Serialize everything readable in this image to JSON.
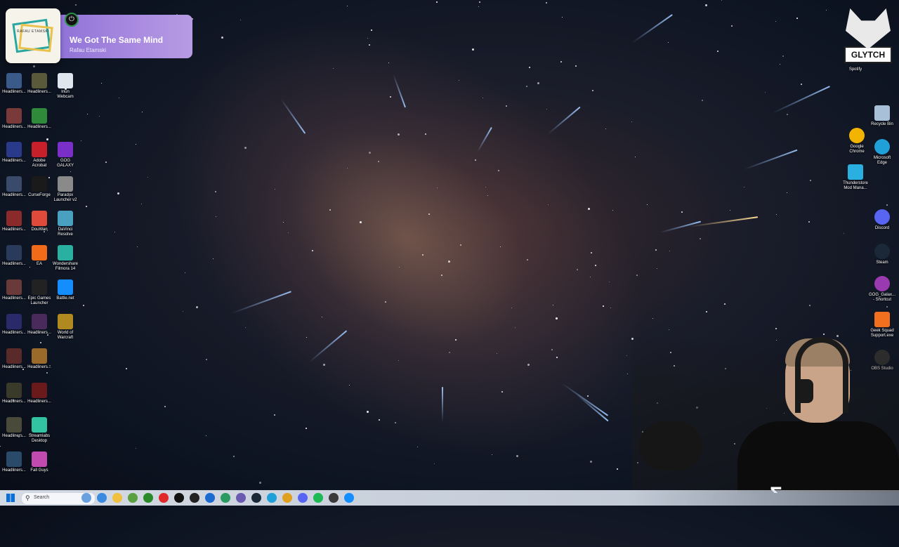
{
  "now_playing": {
    "title": "We Got The Same Mind",
    "artist": "Rafau Etamski",
    "art_text": "RAFAU ETAMSKI"
  },
  "left_icons": [
    {
      "name": "headliners-1",
      "label": "Headliners...",
      "color": "#3a5a8a"
    },
    {
      "name": "headliners-2",
      "label": "Headliners...",
      "color": "#5a5a3a"
    },
    {
      "name": "inun-webcam",
      "label": "Inun\nWebcam",
      "color": "#dfe6ee"
    },
    {
      "name": "headliners-3",
      "label": "Headliners...",
      "color": "#7a3a3a"
    },
    {
      "name": "headliners-4",
      "label": "Headliners...",
      "color": "#2f8a3a"
    },
    {
      "name": "headliners-5",
      "label": "Headliners...",
      "color": "#2a3a8a"
    },
    {
      "name": "adobe-acrobat",
      "label": "Adobe\nAcrobat",
      "color": "#c8202a"
    },
    {
      "name": "gog-galaxy",
      "label": "GOG\nGALAXY",
      "color": "#7b2fc9"
    },
    {
      "name": "headliners-6",
      "label": "Headliners...",
      "color": "#3a4a6a"
    },
    {
      "name": "curseforge",
      "label": "CurseForge",
      "color": "#1a1a1a"
    },
    {
      "name": "paradox-launcher",
      "label": "Paradox\nLauncher v2",
      "color": "#8a8a8a"
    },
    {
      "name": "headliners-7",
      "label": "Headliners...",
      "color": "#8a2a2a"
    },
    {
      "name": "douwan",
      "label": "DouWan",
      "color": "#e04a3a"
    },
    {
      "name": "davinci-resolve",
      "label": "DaVinci\nResolve",
      "color": "#4aa0c0"
    },
    {
      "name": "headliners-8",
      "label": "Headliners...",
      "color": "#2a3a5a"
    },
    {
      "name": "ea",
      "label": "EA",
      "color": "#f06a1a"
    },
    {
      "name": "wondershare-filmora",
      "label": "Wondershare\nFilmora 14",
      "color": "#2ab0a0"
    },
    {
      "name": "headliners-9",
      "label": "Headliners...",
      "color": "#6a3a3a"
    },
    {
      "name": "epic-games",
      "label": "Epic Games\nLauncher",
      "color": "#222222"
    },
    {
      "name": "battle-net",
      "label": "Battle.net",
      "color": "#148eff"
    },
    {
      "name": "headliners-10",
      "label": "Headliners...",
      "color": "#2a2a6a"
    },
    {
      "name": "headliners-11",
      "label": "Headliners...",
      "color": "#4a2a5a"
    },
    {
      "name": "world-of-warcraft",
      "label": "World of\nWarcraft",
      "color": "#b08a20"
    },
    {
      "name": "headliners-12",
      "label": "Headliners...",
      "color": "#5a2a2a"
    },
    {
      "name": "headliners-13",
      "label": "Headliners...",
      "color": "#9a6a2a"
    },
    {
      "name": "headliners-14",
      "label": "Headliners...",
      "color": "#3a3a2a"
    },
    {
      "name": "headliners-15",
      "label": "Headliners...",
      "color": "#6a1a1a"
    },
    {
      "name": "headliners-16",
      "label": "Headliners...",
      "color": "#4a4a3a"
    },
    {
      "name": "streamlabs-desktop",
      "label": "Streamlabs\nDesktop",
      "color": "#31c3a2"
    },
    {
      "name": "headliners-17",
      "label": "Headliners...",
      "color": "#2a4a6a"
    },
    {
      "name": "fall-guys",
      "label": "Fall Guys",
      "color": "#c04ab0"
    }
  ],
  "right_icons": [
    {
      "name": "spotify",
      "label": "Spotify",
      "color": "#1db954"
    },
    {
      "name": "recycle-bin",
      "label": "Recycle Bin",
      "color": "#a8c0d8"
    },
    {
      "name": "google-chrome",
      "label": "Google\nChrome",
      "color": "#f2b400"
    },
    {
      "name": "microsoft-edge",
      "label": "Microsoft\nEdge",
      "color": "#1fa0d8"
    },
    {
      "name": "thunderstore",
      "label": "Thunderstore\nMod Mana...",
      "color": "#2ab0e0"
    },
    {
      "name": "discord",
      "label": "Discord",
      "color": "#5865f2"
    },
    {
      "name": "steam",
      "label": "Steam",
      "color": "#1b2838"
    },
    {
      "name": "gog-galaxy-shortcut",
      "label": "GOG_Galax...\n- Shortcut",
      "color": "#9a3ab0"
    },
    {
      "name": "geek-squad",
      "label": "Geek Squad\nSupport.exe",
      "color": "#f07020"
    },
    {
      "name": "obs-studio",
      "label": "OBS Studio",
      "color": "#303030"
    }
  ],
  "logo": {
    "text": "GLYTCH"
  },
  "taskbar": {
    "search_placeholder": "Search",
    "apps": [
      "weather",
      "copilot",
      "file-explorer",
      "minecraft",
      "xbox",
      "roblox",
      "tiktok",
      "chatgpt",
      "mail",
      "meet",
      "photos",
      "steam",
      "edge",
      "chrome",
      "discord",
      "spotify",
      "game-bar",
      "battle-net"
    ]
  },
  "webcam": {
    "shirt_logo": "Σ"
  }
}
